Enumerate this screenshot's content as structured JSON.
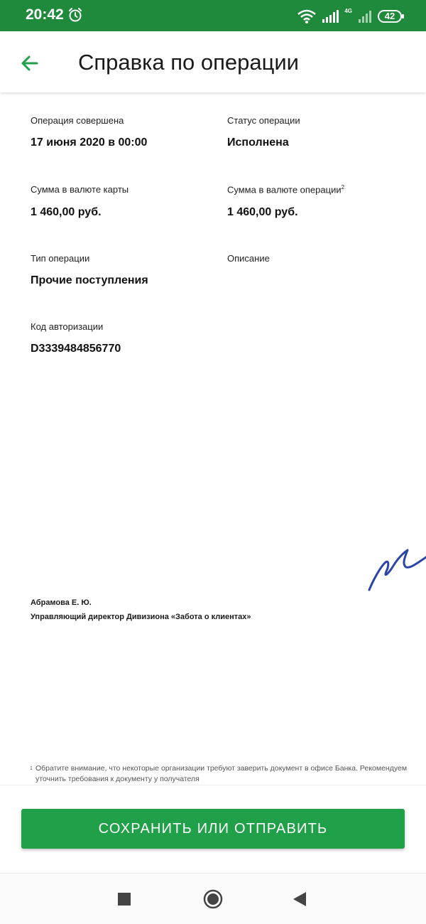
{
  "status_bar": {
    "time": "20:42",
    "network_label": "4G",
    "battery": "42"
  },
  "header": {
    "back_icon": "arrow-left-icon",
    "title": "Справка по операции"
  },
  "details": {
    "operation_date": {
      "label": "Операция совершена",
      "value": "17 июня 2020 в 00:00"
    },
    "status": {
      "label": "Статус операции",
      "value": "Исполнена"
    },
    "amount_card": {
      "label": "Сумма в валюте карты",
      "value": "1 460,00 руб."
    },
    "amount_operation": {
      "label": "Сумма в валюте операции",
      "footnote_mark": "2",
      "value": "1 460,00 руб."
    },
    "operation_type": {
      "label": "Тип операции",
      "value": "Прочие поступления"
    },
    "description": {
      "label": "Описание",
      "value": ""
    },
    "auth_code": {
      "label": "Код авторизации",
      "value": "D3339484856770"
    }
  },
  "signature": {
    "name": "Абрамова Е. Ю.",
    "position": "Управляющий директор Дивизиона «Забота о клиентах»"
  },
  "footnote": {
    "mark": "1",
    "text": "Обратите внимание, что некоторые организации требуют заверить документ в офисе Банка. Рекомендуем уточнить требования к документу у получателя"
  },
  "action_button": {
    "label": "СОХРАНИТЬ ИЛИ ОТПРАВИТЬ"
  },
  "nav_bar": {
    "recents_icon": "square-icon",
    "home_icon": "circle-icon",
    "back_icon": "triangle-back-icon"
  },
  "colors": {
    "status_bar": "#1f8a3c",
    "accent": "#21a04a",
    "signature_ink": "#2a45a8"
  }
}
